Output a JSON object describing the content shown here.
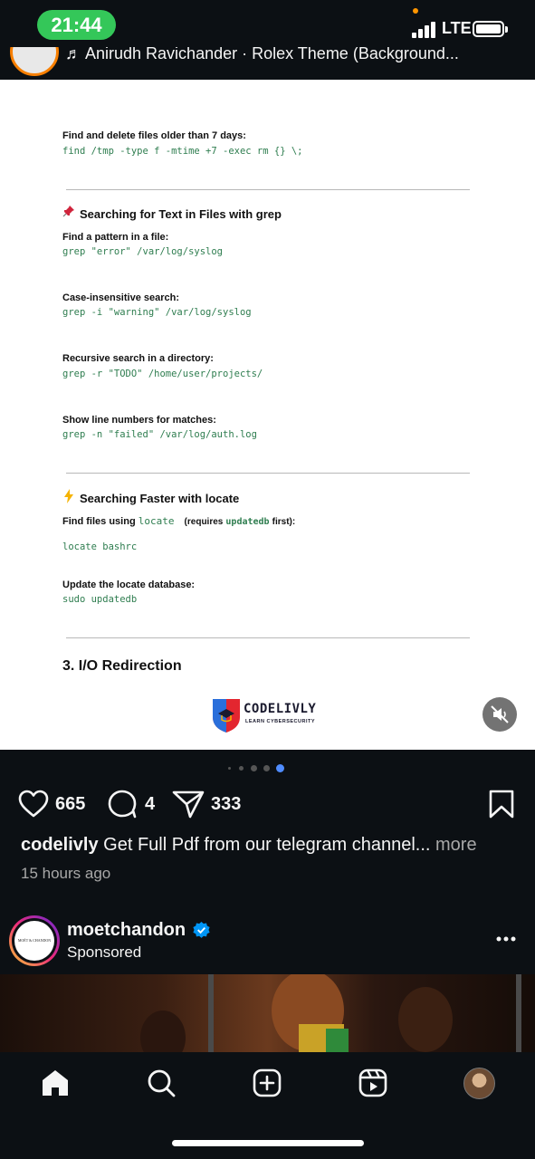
{
  "status_bar": {
    "time": "21:44",
    "network": "LTE"
  },
  "now_playing": {
    "text": "♬ Anirudh Ravichander · Rolex Theme (Background..."
  },
  "post_document": {
    "find_old_files_label": "Find and delete files older than 7 days:",
    "find_old_files_cmd": "find /tmp -type f -mtime +7 -exec rm {} \\;",
    "grep_heading": "Searching for Text in Files with grep",
    "grep_pattern_label": "Find a pattern in a file:",
    "grep_pattern_cmd": "grep \"error\" /var/log/syslog",
    "grep_case_label": "Case-insensitive search:",
    "grep_case_cmd": "grep -i \"warning\" /var/log/syslog",
    "grep_recursive_label": "Recursive search in a directory:",
    "grep_recursive_cmd": "grep -r \"TODO\" /home/user/projects/",
    "grep_lines_label": "Show line numbers for matches:",
    "grep_lines_cmd": "grep -n \"failed\" /var/log/auth.log",
    "locate_heading": "Searching Faster with locate",
    "locate_find_label_pre": "Find files using",
    "locate_find_label_code": "locate",
    "locate_find_label_req": "(requires",
    "locate_find_label_req_code": "updatedb",
    "locate_find_label_req_post": "first):",
    "locate_find_cmd": "locate bashrc",
    "locate_update_label": "Update the locate database:",
    "locate_update_cmd": "sudo updatedb",
    "section_heading": "3. I/O Redirection",
    "logo_name": "CODELIVLY",
    "logo_tagline": "LEARN CYBERSECURITY"
  },
  "carousel": {
    "total": 5,
    "active_index": 4
  },
  "post_actions": {
    "likes": "665",
    "comments": "4",
    "shares": "333"
  },
  "caption": {
    "username": "codelivly",
    "text": "Get Full Pdf from our telegram channel...",
    "more": "more",
    "timestamp": "15 hours ago"
  },
  "sponsored_post": {
    "username": "moetchandon",
    "subtitle": "Sponsored",
    "avatar_text": "MOËT & CHANDON"
  },
  "colors": {
    "background": "#0c1014",
    "time_pill": "#34c759",
    "code_green": "#2e7d4f",
    "active_dot": "#4f8cff",
    "verified": "#0095f6"
  },
  "icons": {
    "home": "home-icon",
    "search": "search-icon",
    "create": "plus-square-icon",
    "reels": "reels-icon",
    "like": "heart-icon",
    "comment": "comment-icon",
    "share": "send-icon",
    "save": "bookmark-icon",
    "mute": "speaker-muted-icon"
  }
}
